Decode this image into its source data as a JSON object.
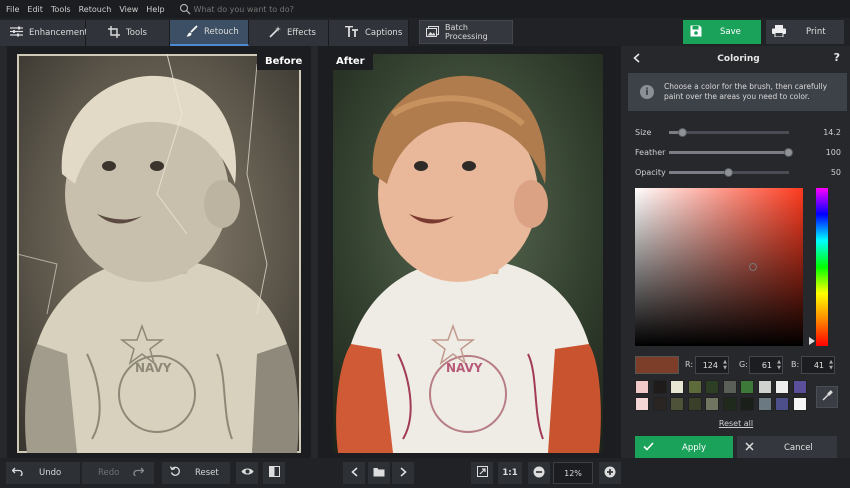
{
  "menu": {
    "items": [
      "File",
      "Edit",
      "Tools",
      "Retouch",
      "View",
      "Help"
    ],
    "search_placeholder": "What do you want to do?"
  },
  "toolbar": {
    "tabs": [
      {
        "label": "Enhancement",
        "icon": "sliders-icon",
        "active": false
      },
      {
        "label": "Tools",
        "icon": "crop-icon",
        "active": false
      },
      {
        "label": "Retouch",
        "icon": "brush-icon",
        "active": true
      },
      {
        "label": "Effects",
        "icon": "magic-wand-icon",
        "active": false
      },
      {
        "label": "Captions",
        "icon": "text-icon",
        "active": false
      }
    ],
    "batch_label": "Batch Processing",
    "save_label": "Save",
    "print_label": "Print"
  },
  "canvas": {
    "before_label": "Before",
    "after_label": "After"
  },
  "panel": {
    "title": "Coloring",
    "help_label": "?",
    "hint": "Choose a color for the brush, then carefully paint over the areas you need to color.",
    "sliders": [
      {
        "label": "Size",
        "value": "14.2",
        "fraction": 0.12
      },
      {
        "label": "Feather",
        "value": "100",
        "fraction": 1.0
      },
      {
        "label": "Opacity",
        "value": "50",
        "fraction": 0.5
      }
    ],
    "color_picker": {
      "saturation": 0.7,
      "brightness": 0.5,
      "hue_position": 0.97
    },
    "rgb": {
      "r_label": "R:",
      "r": "124",
      "g_label": "G:",
      "g": "61",
      "b_label": "B:",
      "b": "41"
    },
    "preview_color": "#7c3d29",
    "swatches": [
      "#f2c9c9",
      "#1e1b1a",
      "#e7e7d4",
      "#5d6a3a",
      "#2c3f24",
      "#5a5f58",
      "#3d7a3a",
      "#cfd2cf",
      "#eeeeee",
      "#5b4f9b",
      "#f5d6d6",
      "#2a2523",
      "#4d5238",
      "#3a3f2a",
      "#6f7560",
      "#1f2a1d",
      "#1a1f1a",
      "#6b7a82",
      "#4c4f8a",
      "#f7f7f7"
    ],
    "reset_all_label": "Reset all",
    "apply_label": "Apply",
    "cancel_label": "Cancel",
    "accent_color": "#1aa25a"
  },
  "bottom": {
    "undo_label": "Undo",
    "redo_label": "Redo",
    "reset_label": "Reset",
    "fit_label": "1:1",
    "zoom_value": "12%"
  }
}
